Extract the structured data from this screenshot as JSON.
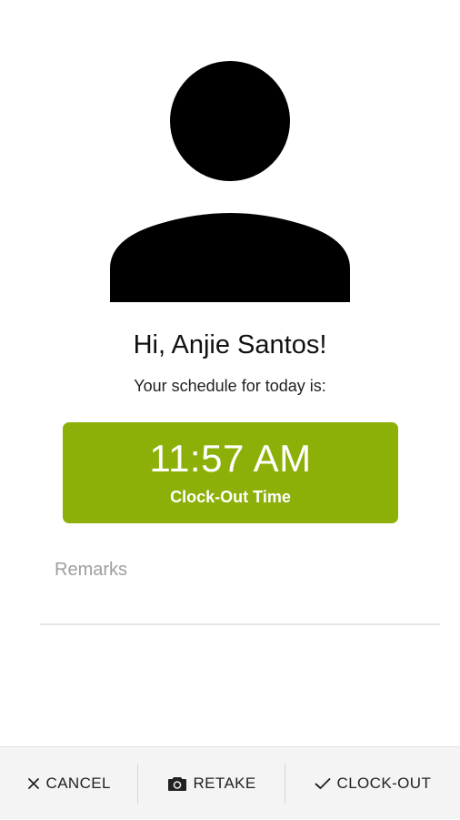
{
  "profile": {
    "avatar_icon": "person-silhouette-icon",
    "greeting": "Hi, Anjie Santos!",
    "schedule_label": "Your schedule for today is:"
  },
  "schedule_card": {
    "time": "11:57 AM",
    "caption": "Clock-Out Time",
    "color": "#8db008"
  },
  "remarks": {
    "placeholder": "Remarks",
    "value": ""
  },
  "actions": {
    "cancel": {
      "label": "CANCEL",
      "icon": "close-icon"
    },
    "retake": {
      "label": "RETAKE",
      "icon": "camera-icon"
    },
    "clock_out": {
      "label": "CLOCK-OUT",
      "icon": "check-icon"
    }
  }
}
